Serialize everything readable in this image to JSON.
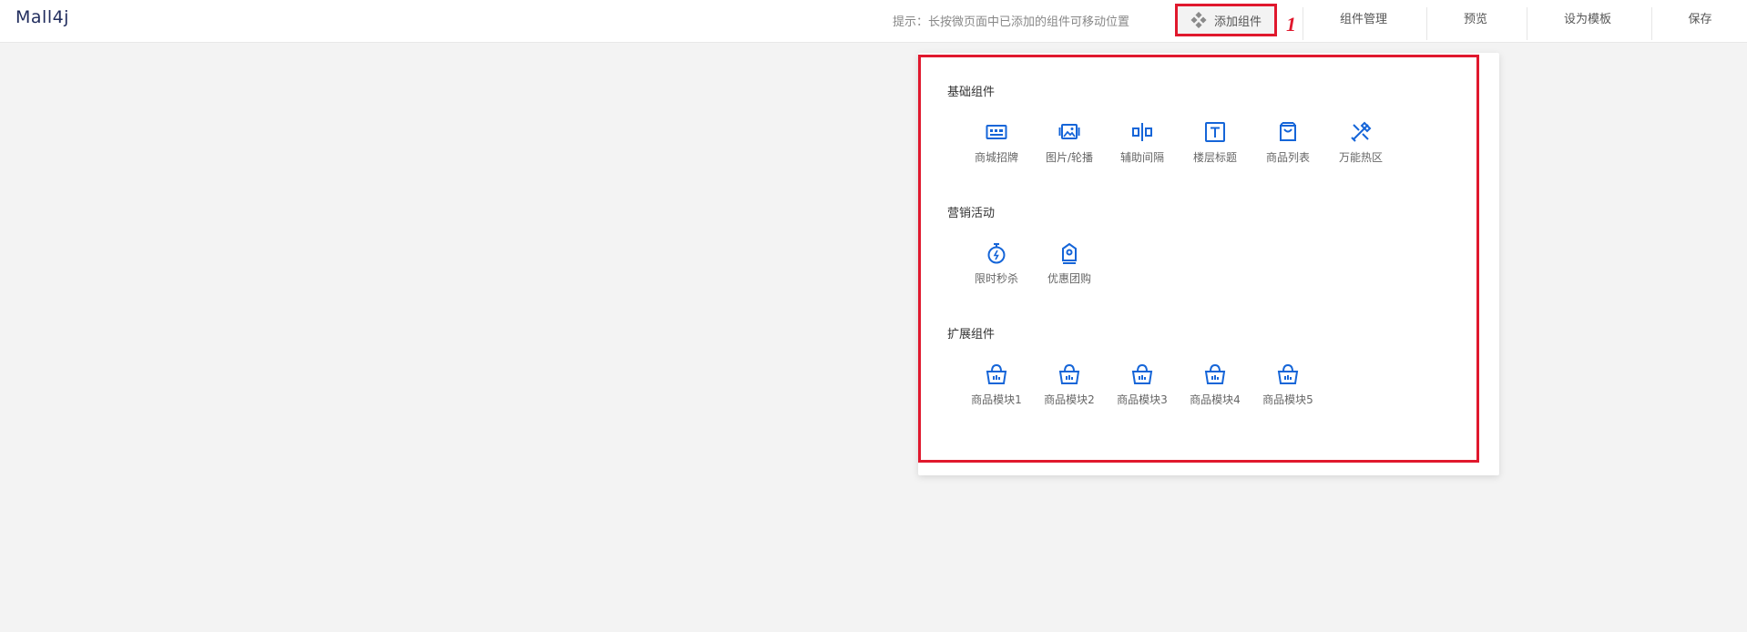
{
  "header": {
    "logo": "Mall4j",
    "hint": "提示：长按微页面中已添加的组件可移动位置",
    "add_component": "添加组件",
    "nav": [
      "组件管理",
      "预览",
      "设为模板",
      "保存"
    ],
    "marker": "1"
  },
  "panel": {
    "sections": [
      {
        "title": "基础组件",
        "items": [
          {
            "label": "商城招牌",
            "icon": "storefront-sign-icon"
          },
          {
            "label": "图片/轮播",
            "icon": "image-carousel-icon"
          },
          {
            "label": "辅助间隔",
            "icon": "spacer-icon"
          },
          {
            "label": "楼层标题",
            "icon": "text-title-icon"
          },
          {
            "label": "商品列表",
            "icon": "shopping-bag-icon"
          },
          {
            "label": "万能热区",
            "icon": "hotspot-tools-icon"
          }
        ]
      },
      {
        "title": "营销活动",
        "items": [
          {
            "label": "限时秒杀",
            "icon": "flash-sale-timer-icon"
          },
          {
            "label": "优惠团购",
            "icon": "group-buy-tag-icon"
          }
        ]
      },
      {
        "title": "扩展组件",
        "items": [
          {
            "label": "商品模块1",
            "icon": "basket-icon"
          },
          {
            "label": "商品模块2",
            "icon": "basket-icon"
          },
          {
            "label": "商品模块3",
            "icon": "basket-icon"
          },
          {
            "label": "商品模块4",
            "icon": "basket-icon"
          },
          {
            "label": "商品模块5",
            "icon": "basket-icon"
          }
        ]
      }
    ]
  },
  "colors": {
    "accent": "#1565d8",
    "highlight": "#e0182d",
    "background": "#f3f3f3"
  }
}
